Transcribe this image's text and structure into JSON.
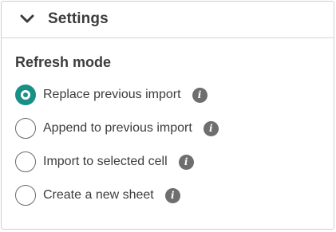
{
  "settings": {
    "header_title": "Settings",
    "section_title": "Refresh mode",
    "options": [
      {
        "label": "Replace previous import",
        "selected": true
      },
      {
        "label": "Append to previous import",
        "selected": false
      },
      {
        "label": "Import to selected cell",
        "selected": false
      },
      {
        "label": "Create a new sheet",
        "selected": false
      }
    ],
    "info_glyph": "i",
    "accent_color": "#1a8f86",
    "icons": {
      "collapse": "chevron-down-icon",
      "info": "info-icon"
    }
  }
}
